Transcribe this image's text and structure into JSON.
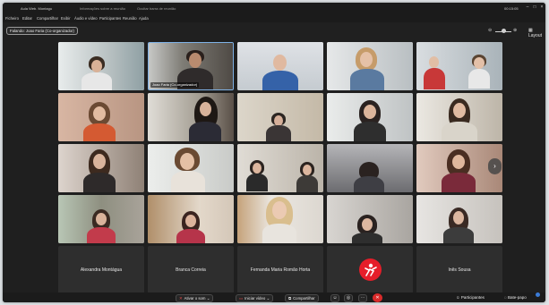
{
  "titlebar": {
    "app_title": "Aula Web. Montagu",
    "info_text": "Informações sobre a reunião",
    "status_text": "Ocultar barra de reunião",
    "clock": "00:15:05"
  },
  "menu": [
    "Ficheiro",
    "Editar",
    "Compartilhar",
    "Exibir",
    "Áudio e vídeo",
    "Participantes",
    "Reunião",
    "Ajuda"
  ],
  "toolbar": {
    "speaker_label": "Falando: Joao Faria (Co-organizador)",
    "layout_label": "Layout"
  },
  "tiles": [
    {
      "name": ""
    },
    {
      "name": "Joao Faria (Co-organizador)"
    },
    {
      "name": ""
    },
    {
      "name": ""
    },
    {
      "name": ""
    },
    {
      "name": ""
    },
    {
      "name": ""
    },
    {
      "name": ""
    },
    {
      "name": ""
    },
    {
      "name": ""
    },
    {
      "name": ""
    },
    {
      "name": ""
    },
    {
      "name": ""
    },
    {
      "name": ""
    },
    {
      "name": ""
    },
    {
      "name": ""
    },
    {
      "name": ""
    },
    {
      "name": ""
    },
    {
      "name": ""
    },
    {
      "name": ""
    }
  ],
  "name_row": [
    {
      "name": "Alexandra Montágua"
    },
    {
      "name": "Branca Correia"
    },
    {
      "name": "Fernanda Maria Romão Horta"
    },
    {
      "name": ""
    },
    {
      "name": "Inês Sousa"
    }
  ],
  "bottombar": {
    "mute_label": "Ativar o som",
    "video_label": "Iniciar vídeo",
    "share_label": "Compartilhar",
    "participants_label": "Participantes",
    "chat_label": "Bate-papo"
  },
  "colors": {
    "window_bg": "#1f1f1f",
    "hangup": "#d92b2b",
    "avatar_red": "#e61e2a",
    "active_speaker_border": "#7fb2e6"
  }
}
